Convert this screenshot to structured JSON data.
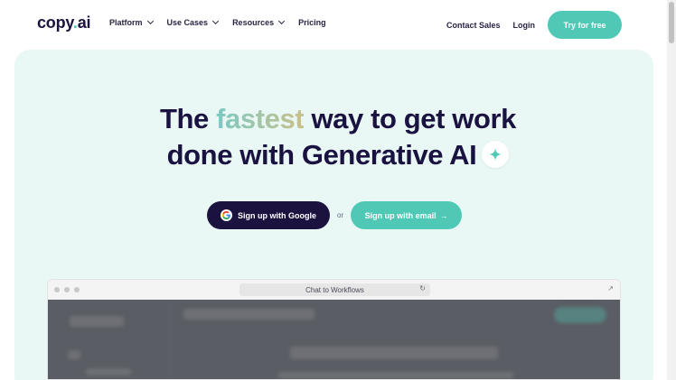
{
  "brand": {
    "name": "copy",
    "dot": ".",
    "suffix": "ai"
  },
  "nav": {
    "items": [
      {
        "label": "Platform"
      },
      {
        "label": "Use Cases"
      },
      {
        "label": "Resources"
      },
      {
        "label": "Pricing"
      }
    ],
    "contact_sales": "Contact Sales",
    "login": "Login",
    "try_free": "Try for free"
  },
  "hero": {
    "headline_prefix": "The ",
    "headline_highlight": "fastest",
    "headline_mid": " way to get work",
    "headline_line2": "done with Generative AI",
    "google_cta": "Sign up with Google",
    "or": "or",
    "email_cta": "Sign up with email",
    "email_arrow": "→"
  },
  "browser": {
    "url_text": "Chat to Workflows"
  },
  "colors": {
    "accent": "#4fc9b6",
    "primary_dark": "#1c1240",
    "hero_bg": "#e9f8f4"
  },
  "icons": {
    "sparkle": "sparkle-icon",
    "google": "google-icon",
    "reload": "reload-icon",
    "expand": "expand-icon"
  }
}
